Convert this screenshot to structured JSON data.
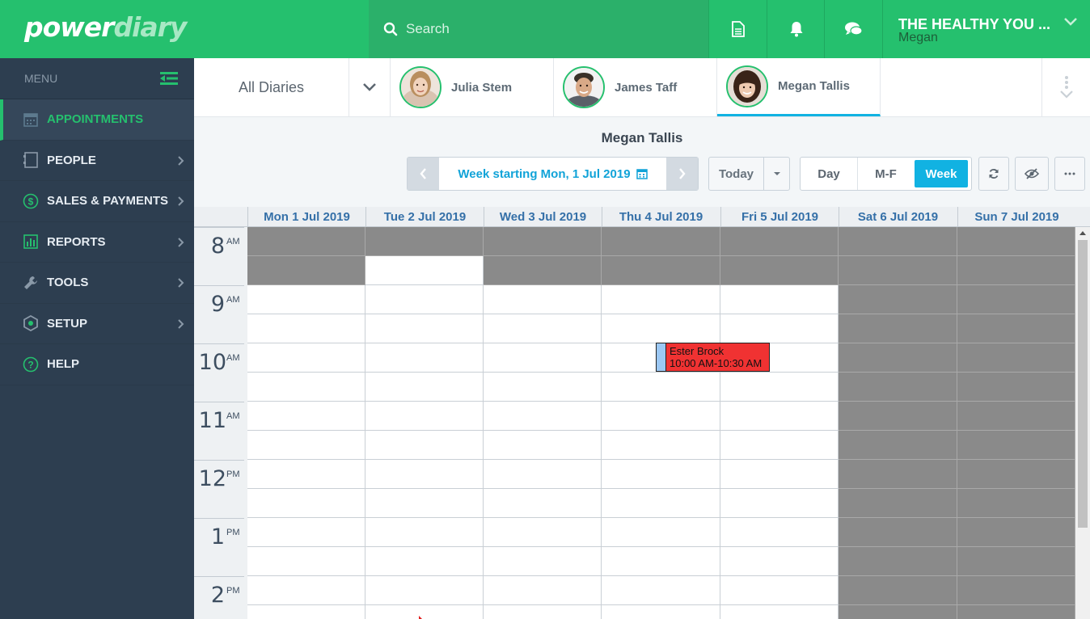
{
  "brand": {
    "logo_primary": "power",
    "logo_secondary": "diary",
    "color": "#25c06e"
  },
  "search": {
    "placeholder": "Search"
  },
  "topbar_icons": [
    "document-icon",
    "bell-icon",
    "chat-icon"
  ],
  "account": {
    "business": "THE HEALTHY YOU ...",
    "user": "Megan"
  },
  "sidebar": {
    "menu_label": "MENU",
    "items": [
      {
        "label": "APPOINTMENTS",
        "icon": "calendar-icon",
        "active": true
      },
      {
        "label": "PEOPLE",
        "icon": "contacts-icon"
      },
      {
        "label": "SALES & PAYMENTS",
        "icon": "dollar-icon"
      },
      {
        "label": "REPORTS",
        "icon": "bar-chart-icon"
      },
      {
        "label": "TOOLS",
        "icon": "wrench-icon"
      },
      {
        "label": "SETUP",
        "icon": "settings-icon"
      },
      {
        "label": "HELP",
        "icon": "question-icon"
      }
    ]
  },
  "diaries": {
    "all_label": "All Diaries",
    "practitioners": [
      {
        "name": "Julia Stem"
      },
      {
        "name": "James Taff"
      },
      {
        "name": "Megan Tallis",
        "selected": true
      }
    ]
  },
  "toolbar": {
    "diary_name": "Megan Tallis",
    "week_label": "Week starting Mon, 1 Jul 2019",
    "today_label": "Today",
    "views": [
      "Day",
      "M-F",
      "Week"
    ],
    "active_view": "Week"
  },
  "calendar": {
    "days": [
      "Mon 1 Jul 2019",
      "Tue 2 Jul 2019",
      "Wed 3 Jul 2019",
      "Thu 4 Jul 2019",
      "Fri 5 Jul 2019",
      "Sat 6 Jul 2019",
      "Sun 7 Jul 2019"
    ],
    "hours": [
      {
        "n": "8",
        "ap": "AM"
      },
      {
        "n": "9",
        "ap": "AM"
      },
      {
        "n": "10",
        "ap": "AM"
      },
      {
        "n": "11",
        "ap": "AM"
      },
      {
        "n": "12",
        "ap": "PM"
      },
      {
        "n": "1",
        "ap": "PM"
      },
      {
        "n": "2",
        "ap": "PM"
      }
    ],
    "appointments": [
      {
        "client": "Ester Brock",
        "time": "10:00 AM-10:30 AM",
        "day": "Thu 4 Jul 2019",
        "color": "#f03232"
      }
    ]
  }
}
